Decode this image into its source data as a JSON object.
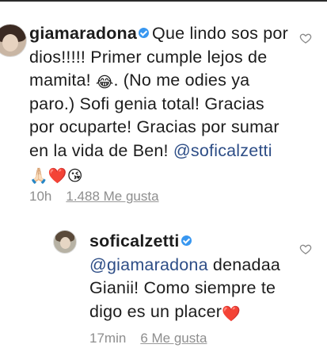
{
  "comments": [
    {
      "username": "giamaradona",
      "text_parts": [
        "Que lindo sos por dios!!!!! Primer cumple lejos de mamita! ",
        "😂",
        ". (No me odies ya paro.) Sofi genia total! Gracias por ocuparte! Gracias por sumar en la vida de Ben! "
      ],
      "mention": "@soficalzetti",
      "trailing_emojis": "🙏🏻❤️😘",
      "time": "10h",
      "likes": "1.488 Me gusta"
    },
    {
      "username": "soficalzetti",
      "mention": "@giamaradona",
      "text": " denadaa Gianii! Como siempre te digo es un placer",
      "trailing_emoji": "❤️",
      "time": "17min",
      "likes": "6 Me gusta"
    }
  ],
  "colors": {
    "verified": "#3897f0",
    "mention": "#2d4d86",
    "meta": "#8e8e8e"
  },
  "icons": [
    "heart-outline-icon",
    "verified-badge-icon"
  ]
}
